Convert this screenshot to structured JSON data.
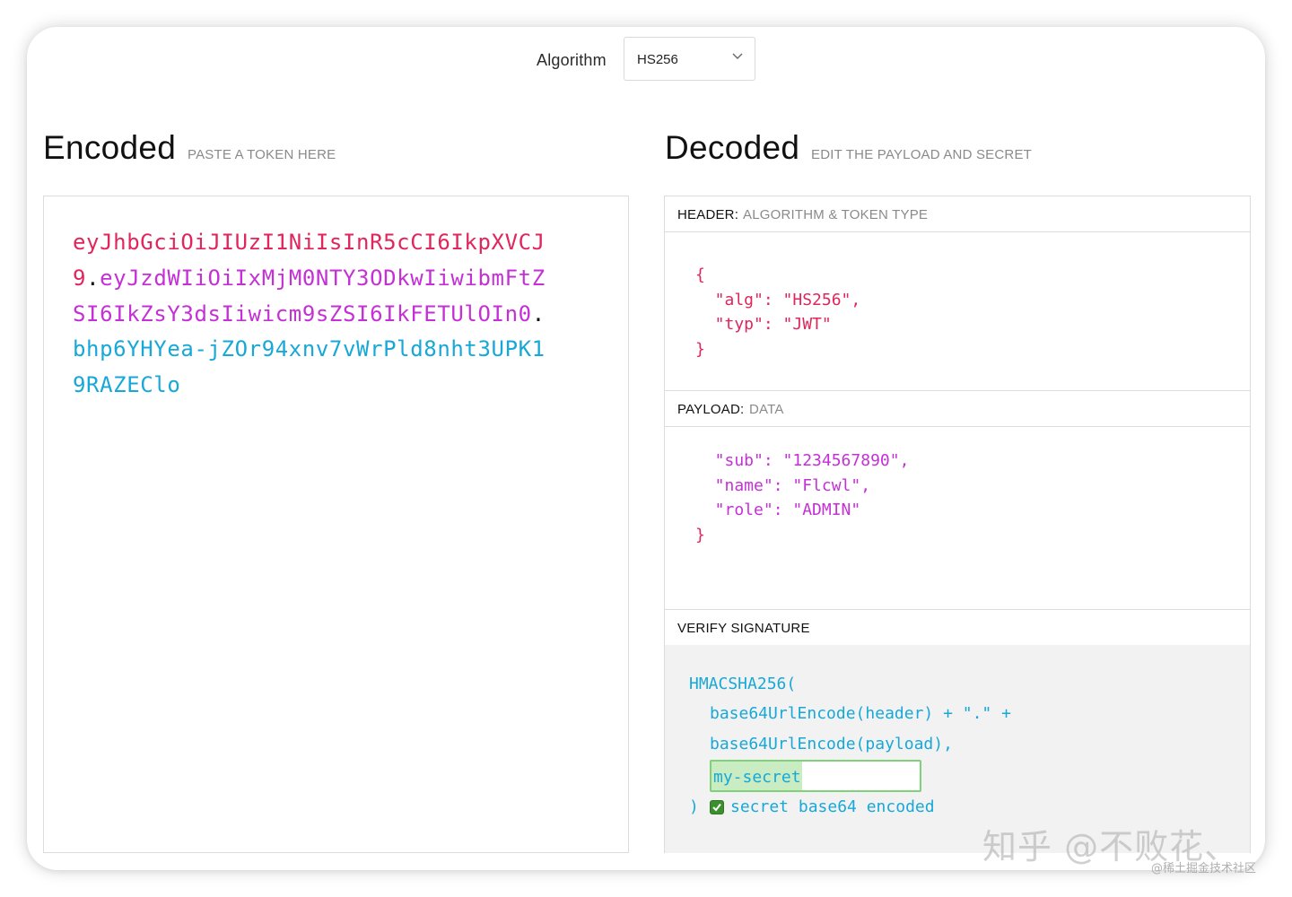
{
  "algorithm": {
    "label": "Algorithm",
    "selected": "HS256"
  },
  "encoded": {
    "title": "Encoded",
    "subtitle": "PASTE A TOKEN HERE",
    "token_header": "eyJhbGciOiJIUzI1NiIsInR5cCI6IkpXVCJ9",
    "token_payload": "eyJzdWIiOiIxMjM0NTY3ODkwIiwibmFtZSI6IkZsY3dsIiwicm9sZSI6IkFETUlOIn0",
    "token_signature": "bhp6YHYea-jZOr94xnv7vWrPld8nht3UPK19RAZEClo",
    "dot": "."
  },
  "decoded": {
    "title": "Decoded",
    "subtitle": "EDIT THE PAYLOAD AND SECRET",
    "header": {
      "key": "HEADER:",
      "desc": "ALGORITHM & TOKEN TYPE",
      "code": [
        "{",
        "  \"alg\": \"HS256\",",
        "  \"typ\": \"JWT\"",
        "}"
      ]
    },
    "payload": {
      "key": "PAYLOAD:",
      "desc": "DATA",
      "code": [
        "  \"sub\": \"1234567890\",",
        "  \"name\": \"Flcwl\",",
        "  \"role\": \"ADMIN\"",
        "}"
      ]
    },
    "verify": {
      "key": "VERIFY SIGNATURE",
      "line1": "HMACSHA256(",
      "line2": "base64UrlEncode(header) + \".\" +",
      "line3": "base64UrlEncode(payload),",
      "secret": "my-secret",
      "close": ")",
      "checkbox_label": "secret base64 encoded",
      "checked": true
    }
  },
  "watermark": {
    "main": "知乎 @不败花、",
    "sub": "@稀土掘金技术社区"
  },
  "colors": {
    "header": "#e0265b",
    "payload": "#c530d6",
    "signature": "#17a8d8"
  }
}
